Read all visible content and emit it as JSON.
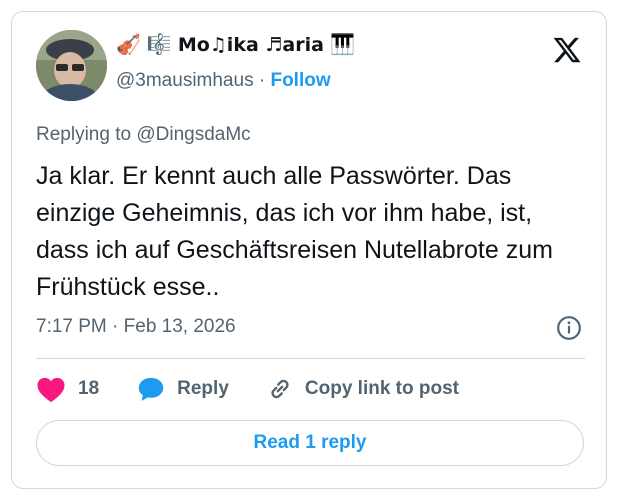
{
  "author": {
    "display_name": "Mo♫ika ♬aria",
    "emoji_prefix": [
      "🎻",
      "🎼"
    ],
    "emoji_suffix": "🎹",
    "handle": "@3mausimhaus",
    "separator": "·",
    "follow_label": "Follow"
  },
  "reply_context": {
    "prefix": "Replying to",
    "mention": "@DingsdaMc"
  },
  "tweet": {
    "text": "Ja klar. Er kennt auch alle Passwörter. Das einzige Geheimnis, das ich vor ihm habe, ist, dass ich auf Geschäftsreisen Nutellabrote zum Frühstück esse..",
    "timestamp": "7:17 PM · Feb 13, 2026"
  },
  "actions": {
    "like_count": "18",
    "reply_label": "Reply",
    "copy_label": "Copy link to post"
  },
  "read_replies_label": "Read 1 reply",
  "colors": {
    "accent": "#1d9bf0",
    "like": "#f91880",
    "muted": "#536471",
    "border": "#cfd9de"
  },
  "icons": [
    "avatar",
    "x-logo-icon",
    "info-icon",
    "heart-icon",
    "reply-bubble-icon",
    "link-icon"
  ]
}
